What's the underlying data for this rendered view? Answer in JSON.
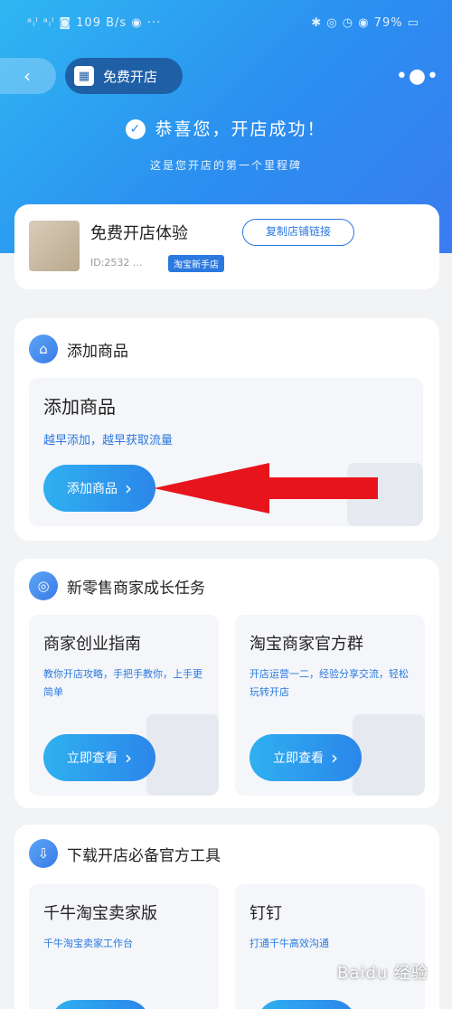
{
  "status_bar": {
    "left": "ᵃᵢˡ ᵃᵢˡ ◙ 109 B/s ◉ ···",
    "right": "✱ ◎ ◷ ◉ 79% ▭"
  },
  "header": {
    "back_icon": "chevron-left-icon",
    "title": "免费开店",
    "store_icon": "store-icon",
    "more_icon": "more-dots-icon"
  },
  "hero": {
    "congrats_text": "恭喜您，开店成功！",
    "congrats_sub": "这是您开店的第一个里程碑"
  },
  "shop_card": {
    "name": "免费开店体验",
    "id_text": "ID:2532 ...",
    "tag": "淘宝新手店",
    "action_label": "复制店铺链接"
  },
  "add_section": {
    "title": "添加商品",
    "card_title": "添加商品",
    "card_subtitle": "越早添加，越早获取流量",
    "button_label": "添加商品"
  },
  "task_section": {
    "title": "新零售商家成长任务",
    "items": [
      {
        "title": "商家创业指南",
        "subtitle": "教你开店攻略，手把手教你，上手更简单",
        "button_label": "立即查看"
      },
      {
        "title": "淘宝商家官方群",
        "subtitle": "开店运营一二，经验分享交流，轻松玩转开店",
        "button_label": "立即查看"
      }
    ]
  },
  "tool_section": {
    "title": "下载开店必备官方工具",
    "items": [
      {
        "title": "千牛淘宝卖家版",
        "subtitle": "千牛淘宝卖家工作台"
      },
      {
        "title": "钉钉",
        "subtitle": "打通千牛高效沟通"
      }
    ]
  },
  "watermark": "Baidu 经验",
  "colors": {
    "accent": "#2b79e0",
    "hero_start": "#2fb6f2",
    "hero_end": "#3a7cf0",
    "arrow": "#e8141c"
  }
}
